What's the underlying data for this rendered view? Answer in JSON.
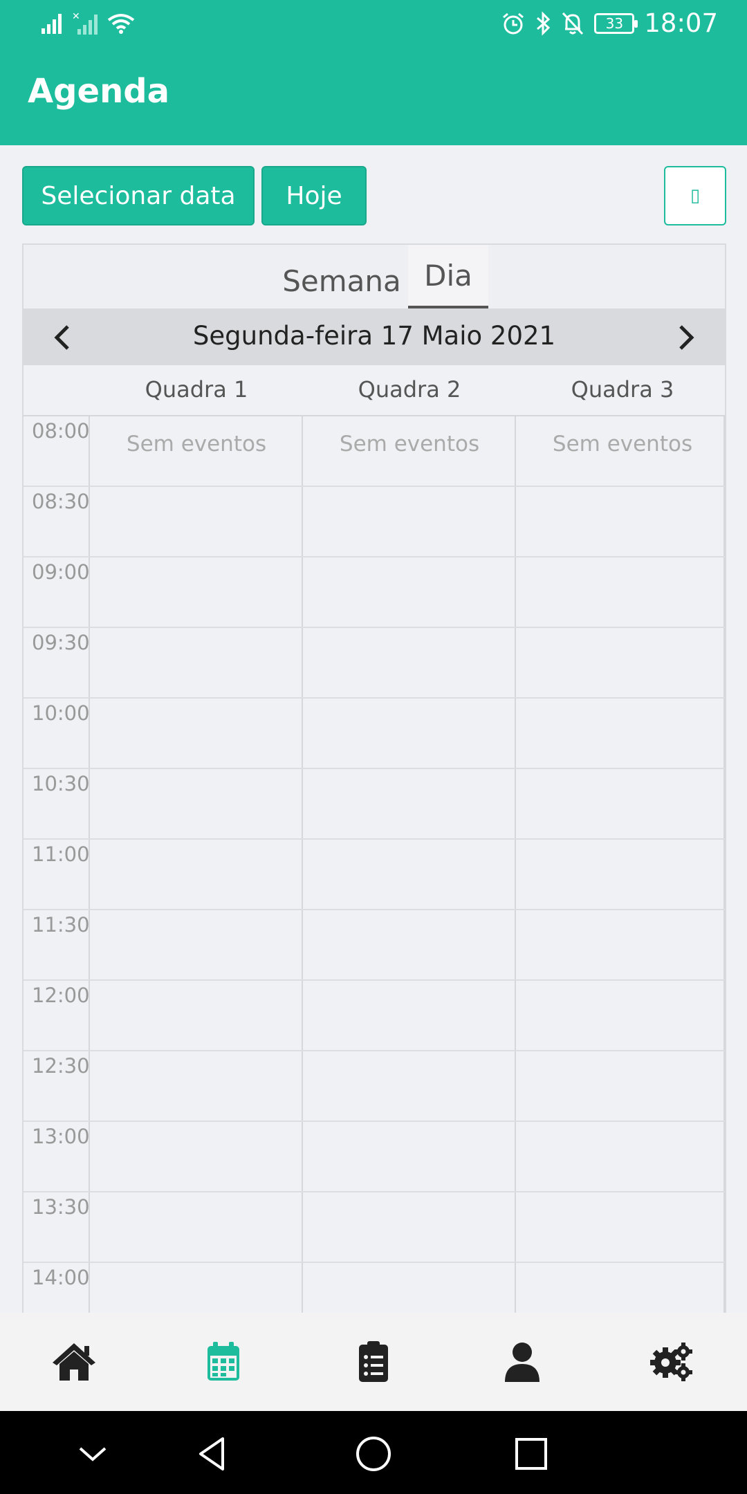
{
  "status_bar": {
    "time": "18:07",
    "battery": "33"
  },
  "app_bar": {
    "title": "Agenda"
  },
  "toolbar": {
    "select_date_label": "Selecionar data",
    "today_label": "Hoje",
    "extra_button_glyph": "▯"
  },
  "calendar": {
    "tabs": [
      {
        "label": "Semana",
        "active": false
      },
      {
        "label": "Dia",
        "active": true
      }
    ],
    "date_label": "Segunda-feira 17 Maio 2021",
    "columns": [
      "Quadra 1",
      "Quadra 2",
      "Quadra 3"
    ],
    "empty_text": "Sem eventos",
    "times": [
      "08:00",
      "08:30",
      "09:00",
      "09:30",
      "10:00",
      "10:30",
      "11:00",
      "11:30",
      "12:00",
      "12:30",
      "13:00",
      "13:30",
      "14:00"
    ]
  },
  "bottom_nav": {
    "items": [
      "home-icon",
      "calendar-icon",
      "clipboard-list-icon",
      "user-icon",
      "gears-icon"
    ],
    "active": "calendar-icon",
    "active_color": "#1dbc9c",
    "icon_color": "#222222"
  },
  "colors": {
    "accent": "#1dbc9c",
    "background": "#f0f1f5"
  }
}
